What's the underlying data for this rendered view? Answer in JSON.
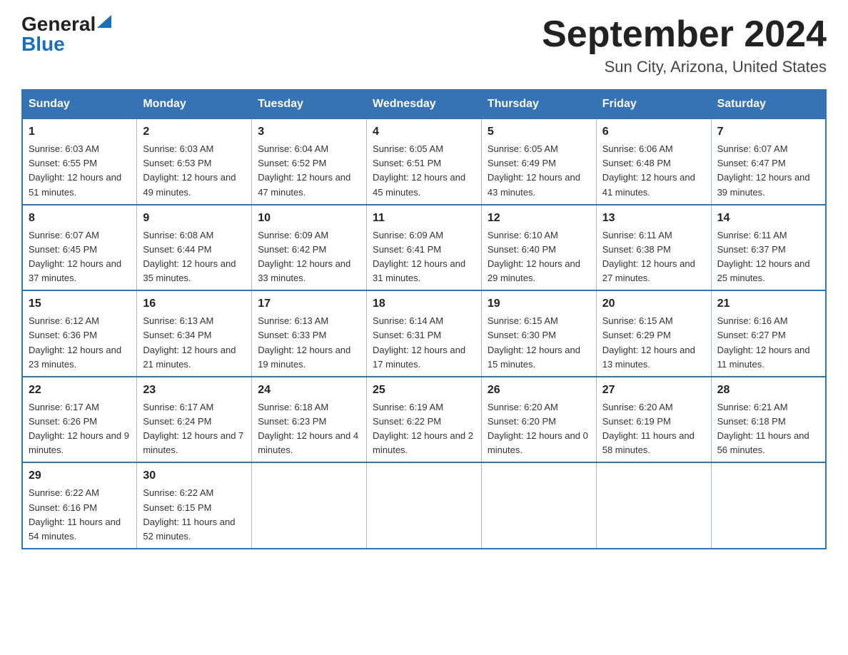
{
  "header": {
    "logo_general": "General",
    "logo_blue": "Blue",
    "month_title": "September 2024",
    "subtitle": "Sun City, Arizona, United States"
  },
  "days_of_week": [
    "Sunday",
    "Monday",
    "Tuesday",
    "Wednesday",
    "Thursday",
    "Friday",
    "Saturday"
  ],
  "weeks": [
    [
      {
        "day": "1",
        "sunrise": "6:03 AM",
        "sunset": "6:55 PM",
        "daylight": "12 hours and 51 minutes."
      },
      {
        "day": "2",
        "sunrise": "6:03 AM",
        "sunset": "6:53 PM",
        "daylight": "12 hours and 49 minutes."
      },
      {
        "day": "3",
        "sunrise": "6:04 AM",
        "sunset": "6:52 PM",
        "daylight": "12 hours and 47 minutes."
      },
      {
        "day": "4",
        "sunrise": "6:05 AM",
        "sunset": "6:51 PM",
        "daylight": "12 hours and 45 minutes."
      },
      {
        "day": "5",
        "sunrise": "6:05 AM",
        "sunset": "6:49 PM",
        "daylight": "12 hours and 43 minutes."
      },
      {
        "day": "6",
        "sunrise": "6:06 AM",
        "sunset": "6:48 PM",
        "daylight": "12 hours and 41 minutes."
      },
      {
        "day": "7",
        "sunrise": "6:07 AM",
        "sunset": "6:47 PM",
        "daylight": "12 hours and 39 minutes."
      }
    ],
    [
      {
        "day": "8",
        "sunrise": "6:07 AM",
        "sunset": "6:45 PM",
        "daylight": "12 hours and 37 minutes."
      },
      {
        "day": "9",
        "sunrise": "6:08 AM",
        "sunset": "6:44 PM",
        "daylight": "12 hours and 35 minutes."
      },
      {
        "day": "10",
        "sunrise": "6:09 AM",
        "sunset": "6:42 PM",
        "daylight": "12 hours and 33 minutes."
      },
      {
        "day": "11",
        "sunrise": "6:09 AM",
        "sunset": "6:41 PM",
        "daylight": "12 hours and 31 minutes."
      },
      {
        "day": "12",
        "sunrise": "6:10 AM",
        "sunset": "6:40 PM",
        "daylight": "12 hours and 29 minutes."
      },
      {
        "day": "13",
        "sunrise": "6:11 AM",
        "sunset": "6:38 PM",
        "daylight": "12 hours and 27 minutes."
      },
      {
        "day": "14",
        "sunrise": "6:11 AM",
        "sunset": "6:37 PM",
        "daylight": "12 hours and 25 minutes."
      }
    ],
    [
      {
        "day": "15",
        "sunrise": "6:12 AM",
        "sunset": "6:36 PM",
        "daylight": "12 hours and 23 minutes."
      },
      {
        "day": "16",
        "sunrise": "6:13 AM",
        "sunset": "6:34 PM",
        "daylight": "12 hours and 21 minutes."
      },
      {
        "day": "17",
        "sunrise": "6:13 AM",
        "sunset": "6:33 PM",
        "daylight": "12 hours and 19 minutes."
      },
      {
        "day": "18",
        "sunrise": "6:14 AM",
        "sunset": "6:31 PM",
        "daylight": "12 hours and 17 minutes."
      },
      {
        "day": "19",
        "sunrise": "6:15 AM",
        "sunset": "6:30 PM",
        "daylight": "12 hours and 15 minutes."
      },
      {
        "day": "20",
        "sunrise": "6:15 AM",
        "sunset": "6:29 PM",
        "daylight": "12 hours and 13 minutes."
      },
      {
        "day": "21",
        "sunrise": "6:16 AM",
        "sunset": "6:27 PM",
        "daylight": "12 hours and 11 minutes."
      }
    ],
    [
      {
        "day": "22",
        "sunrise": "6:17 AM",
        "sunset": "6:26 PM",
        "daylight": "12 hours and 9 minutes."
      },
      {
        "day": "23",
        "sunrise": "6:17 AM",
        "sunset": "6:24 PM",
        "daylight": "12 hours and 7 minutes."
      },
      {
        "day": "24",
        "sunrise": "6:18 AM",
        "sunset": "6:23 PM",
        "daylight": "12 hours and 4 minutes."
      },
      {
        "day": "25",
        "sunrise": "6:19 AM",
        "sunset": "6:22 PM",
        "daylight": "12 hours and 2 minutes."
      },
      {
        "day": "26",
        "sunrise": "6:20 AM",
        "sunset": "6:20 PM",
        "daylight": "12 hours and 0 minutes."
      },
      {
        "day": "27",
        "sunrise": "6:20 AM",
        "sunset": "6:19 PM",
        "daylight": "11 hours and 58 minutes."
      },
      {
        "day": "28",
        "sunrise": "6:21 AM",
        "sunset": "6:18 PM",
        "daylight": "11 hours and 56 minutes."
      }
    ],
    [
      {
        "day": "29",
        "sunrise": "6:22 AM",
        "sunset": "6:16 PM",
        "daylight": "11 hours and 54 minutes."
      },
      {
        "day": "30",
        "sunrise": "6:22 AM",
        "sunset": "6:15 PM",
        "daylight": "11 hours and 52 minutes."
      },
      null,
      null,
      null,
      null,
      null
    ]
  ]
}
